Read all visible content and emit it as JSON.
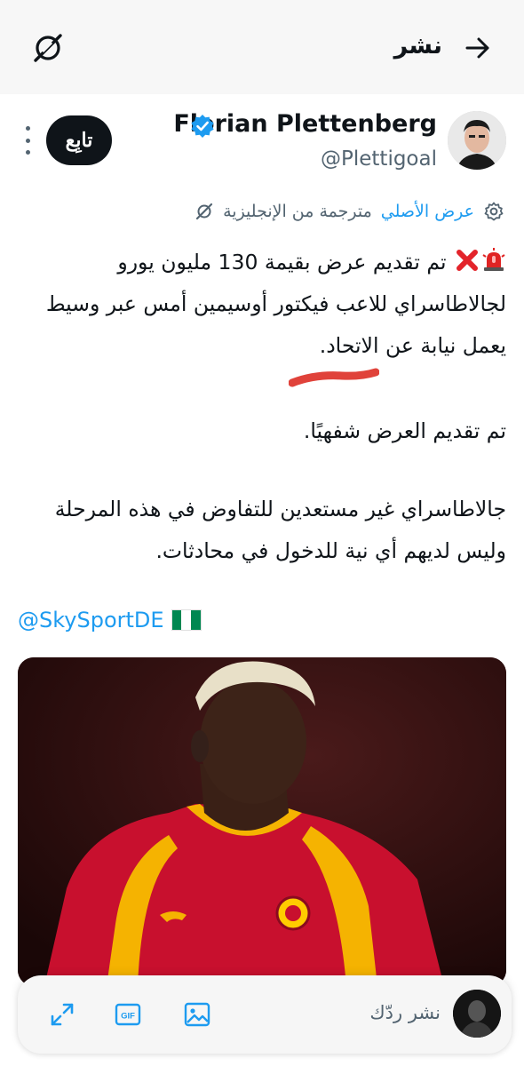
{
  "header": {
    "title": "نشر",
    "back_icon": "arrow-right-icon",
    "grok_icon": "grok-icon"
  },
  "author": {
    "name": "Florian Plettenberg",
    "handle": "@Plettigoal",
    "verified": true,
    "follow_label": "تابِع"
  },
  "translation": {
    "label": "مترجمة من الإنجليزية",
    "show_original": "عرض الأصلي"
  },
  "tweet": {
    "line1": "تم تقديم عرض بقيمة 130 مليون يورو لجالاطاسراي للاعب فيكتور أوسيمين أمس عبر وسيط يعمل نيابة عن الاتحاد.",
    "line2": "تم تقديم العرض شفهيًا.",
    "line3": "جالاطاسراي غير مستعدين للتفاوض في هذه المرحلة وليس لديهم أي نية للدخول في محادثات.",
    "mention": "@SkySportDE",
    "flag_colors": [
      "#008751",
      "#ffffff",
      "#008751"
    ]
  },
  "reply_bar": {
    "placeholder": "نشر ردّك",
    "gif_label": "GIF"
  },
  "colors": {
    "accent": "#1d9bf0",
    "text": "#0f1419",
    "muted": "#536471",
    "jersey_red": "#c8102e",
    "jersey_yellow": "#f5b301"
  }
}
